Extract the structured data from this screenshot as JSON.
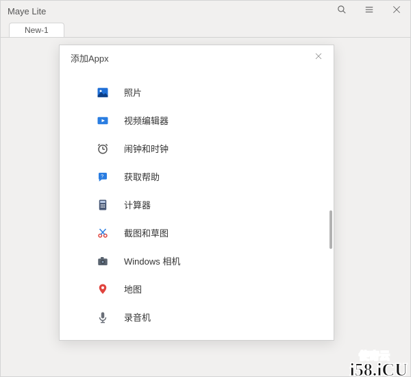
{
  "window": {
    "title": "Maye Lite"
  },
  "tabs": [
    {
      "label": "New-1"
    }
  ],
  "dialog": {
    "title": "添加Appx",
    "items": [
      {
        "name": "photos",
        "label": "照片"
      },
      {
        "name": "video-editor",
        "label": "视频编辑器"
      },
      {
        "name": "clock",
        "label": "闹钟和时钟"
      },
      {
        "name": "get-help",
        "label": "获取帮助"
      },
      {
        "name": "calculator",
        "label": "计算器"
      },
      {
        "name": "snip",
        "label": "截图和草图"
      },
      {
        "name": "camera",
        "label": "Windows 相机"
      },
      {
        "name": "maps",
        "label": "地图"
      },
      {
        "name": "recorder",
        "label": "录音机"
      }
    ]
  },
  "watermark": {
    "small": "使奇云",
    "main": "i58.iCU"
  }
}
